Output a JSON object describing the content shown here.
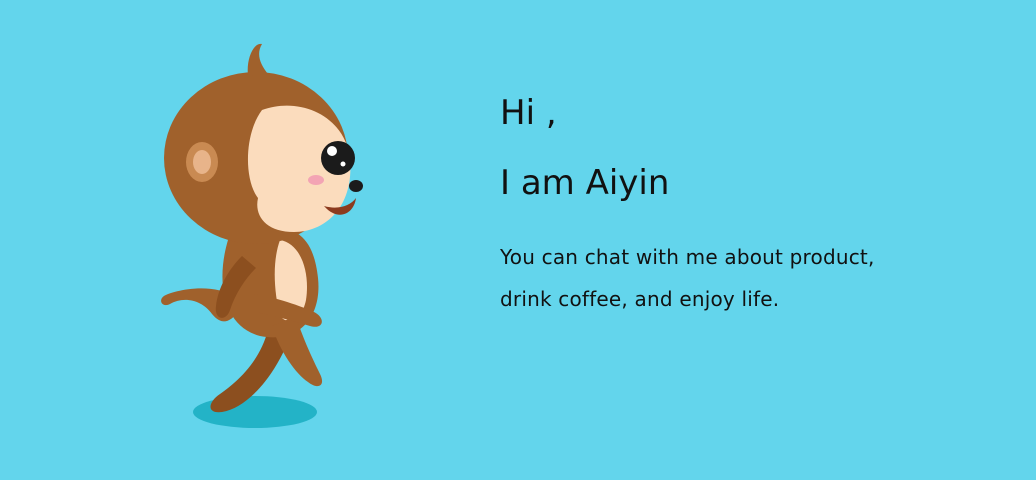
{
  "hero": {
    "greeting": "Hi ,",
    "intro": "I am Aiyin",
    "description_line1": "You can chat with me about product,",
    "description_line2": "drink coffee, and enjoy life."
  },
  "mascot": {
    "icon": "monkey-mascot-icon"
  },
  "colors": {
    "background": "#63d5ec",
    "text": "#111111",
    "fur": "#a0612c",
    "face": "#fbdcbd",
    "shadow": "#23b3c7"
  }
}
